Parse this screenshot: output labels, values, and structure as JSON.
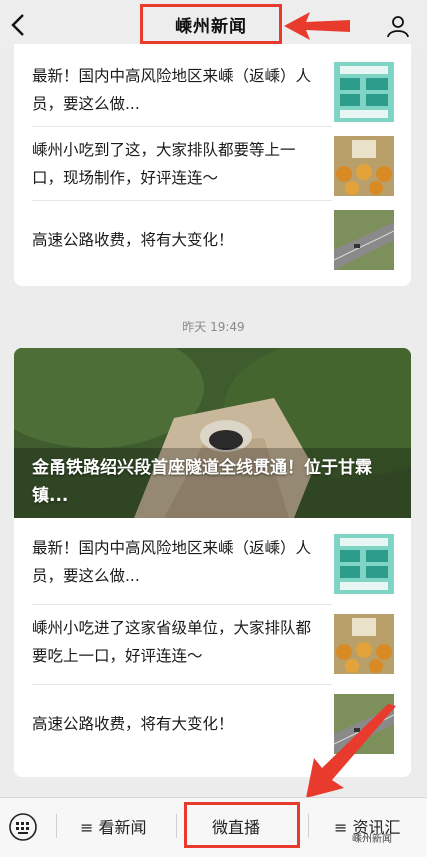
{
  "header": {
    "title": "嵊州新闻",
    "back_icon": "chevron-left-icon",
    "profile_icon": "person-icon"
  },
  "accent": "#e83b2d",
  "group1": {
    "items": [
      {
        "text": "最新！国内中高风险地区来嵊（返嵊）人员，要这么做..."
      },
      {
        "text": "嵊州小吃到了这，大家排队都要等上一口，现场制作，好评连连～"
      },
      {
        "text": "高速公路收费，将有大变化！"
      }
    ]
  },
  "timestamp": "昨天 19:49",
  "group2": {
    "headline": "金甬铁路绍兴段首座隧道全线贯通！位于甘霖镇...",
    "items": [
      {
        "text": "最新！国内中高风险地区来嵊（返嵊）人员，要这么做..."
      },
      {
        "text": "嵊州小吃进了这家省级单位，大家排队都要吃上一口，好评连连～"
      },
      {
        "text": "高速公路收费，将有大变化！"
      }
    ]
  },
  "bottom_menu": {
    "keyboard_icon": "keyboard-icon",
    "tab1": "≡ 看新闻",
    "tab2": "微直播",
    "tab3": "≡ 资讯汇"
  },
  "watermark": "嵊州新闻"
}
